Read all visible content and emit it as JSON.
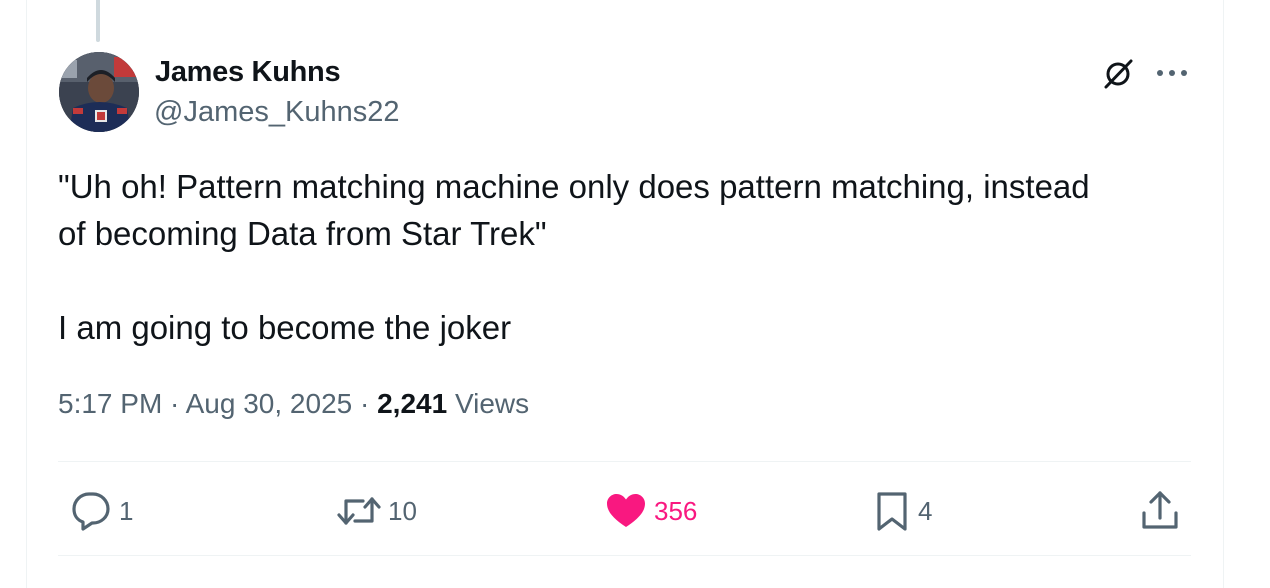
{
  "tweet": {
    "author": {
      "name": "James Kuhns",
      "handle": "@James_Kuhns22"
    },
    "text_lines": [
      "\"Uh oh! Pattern matching machine only does pattern matching, instead",
      "of becoming Data from Star Trek\""
    ],
    "text_para2": "I am going to become the joker",
    "meta": {
      "time": "5:17 PM",
      "sep1": " · ",
      "date": "Aug 30, 2025",
      "sep2": " · ",
      "views_count": "2,241",
      "views_label": " Views"
    },
    "actions": {
      "replies": "1",
      "reposts": "10",
      "likes": "356",
      "bookmarks": "4"
    }
  },
  "icons": {
    "header": [
      "grok-icon",
      "more-icon"
    ],
    "actions": [
      "reply-icon",
      "repost-icon",
      "like-icon",
      "bookmark-icon",
      "share-icon"
    ]
  },
  "colors": {
    "text_primary": "#0f1419",
    "text_secondary": "#536471",
    "like_active": "#f91880",
    "divider": "#eff3f4"
  }
}
